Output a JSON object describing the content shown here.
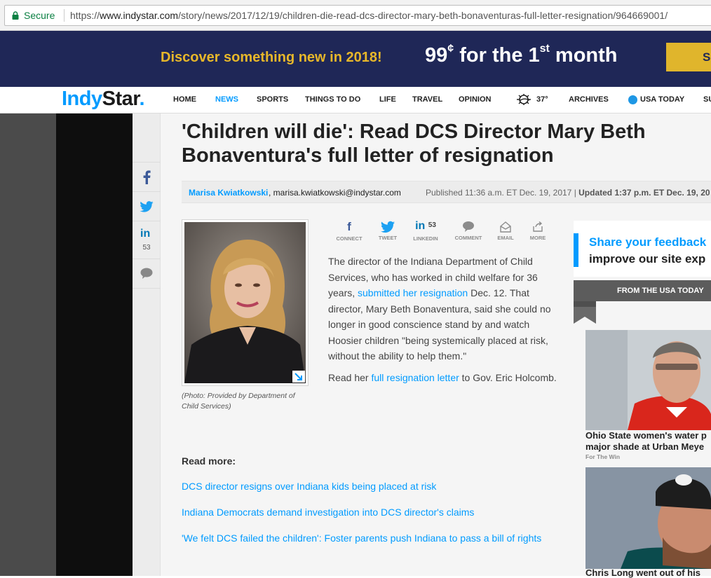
{
  "browser": {
    "secure_label": "Secure",
    "url_scheme": "https://",
    "url_domain": "www.indystar.com",
    "url_path": "/story/news/2017/12/19/children-die-read-dcs-director-mary-beth-bonaventuras-full-letter-resignation/964669001/"
  },
  "promo": {
    "left_text": "Discover something new in 2018!",
    "price": "99",
    "cent": "¢",
    "right_text_mid": " for the 1",
    "right_sup": "st",
    "right_text_end": " month",
    "button_label": "Su"
  },
  "nav": {
    "logo_indy": "Indy",
    "logo_star": "Star",
    "logo_dot": ".",
    "items": [
      "HOME",
      "NEWS",
      "SPORTS",
      "THINGS TO DO",
      "LIFE",
      "TRAVEL",
      "OPINION",
      "37°",
      "ARCHIVES",
      "USA TODAY",
      "SU"
    ],
    "active": "NEWS"
  },
  "rail": {
    "linkedin_count": "53"
  },
  "article": {
    "headline": "'Children will die': Read DCS Director Mary Beth Bonaventura's full letter of resignation",
    "author": "Marisa Kwiatkowski",
    "author_email": ", marisa.kwiatkowski@indystar.com",
    "published": "Published 11:36 a.m. ET Dec. 19, 2017 | ",
    "updated": "Updated 1:37 p.m. ET Dec. 19, 20",
    "caption": "(Photo: Provided by Department of Child Services)",
    "share": [
      {
        "label": "CONNECT",
        "count": ""
      },
      {
        "label": "TWEET",
        "count": ""
      },
      {
        "label": "LINKEDIN",
        "count": "53"
      },
      {
        "label": "COMMENT",
        "count": ""
      },
      {
        "label": "EMAIL",
        "count": ""
      },
      {
        "label": "MORE",
        "count": ""
      }
    ],
    "p1_a": "The director of the Indiana Department of Child Services, who has worked in child welfare for 36 years, ",
    "p1_link": "submitted her resignation",
    "p1_b": " Dec. 12. That director, Mary Beth Bonaventura, said she could no longer in good conscience stand by and watch Hoosier children \"being systemically placed at risk, without the ability to help them.\"",
    "p2_a": "Read her ",
    "p2_link": "full resignation letter",
    "p2_b": " to Gov. Eric Holcomb.",
    "read_more_label": "Read more:",
    "read_more": [
      "DCS director resigns over Indiana kids being placed at risk",
      "Indiana Democrats demand investigation into DCS director's claims",
      "'We felt DCS failed the children': Foster parents push Indiana to pass a bill of rights"
    ]
  },
  "sidebar": {
    "feedback_line1": "Share your feedback",
    "feedback_line2": "improve our site exp",
    "usat_label": "FROM THE USA TODAY",
    "cards": [
      {
        "title_line1": "Ohio State women's water p",
        "title_line2": "major shade at Urban Meye",
        "source": "For The Win"
      },
      {
        "title_line1": "Chris Long went out of his",
        "title_line2": "",
        "source": ""
      }
    ]
  },
  "colors": {
    "brand_blue": "#009bff",
    "promo_navy": "#1f2757",
    "promo_gold": "#e7b72a"
  }
}
